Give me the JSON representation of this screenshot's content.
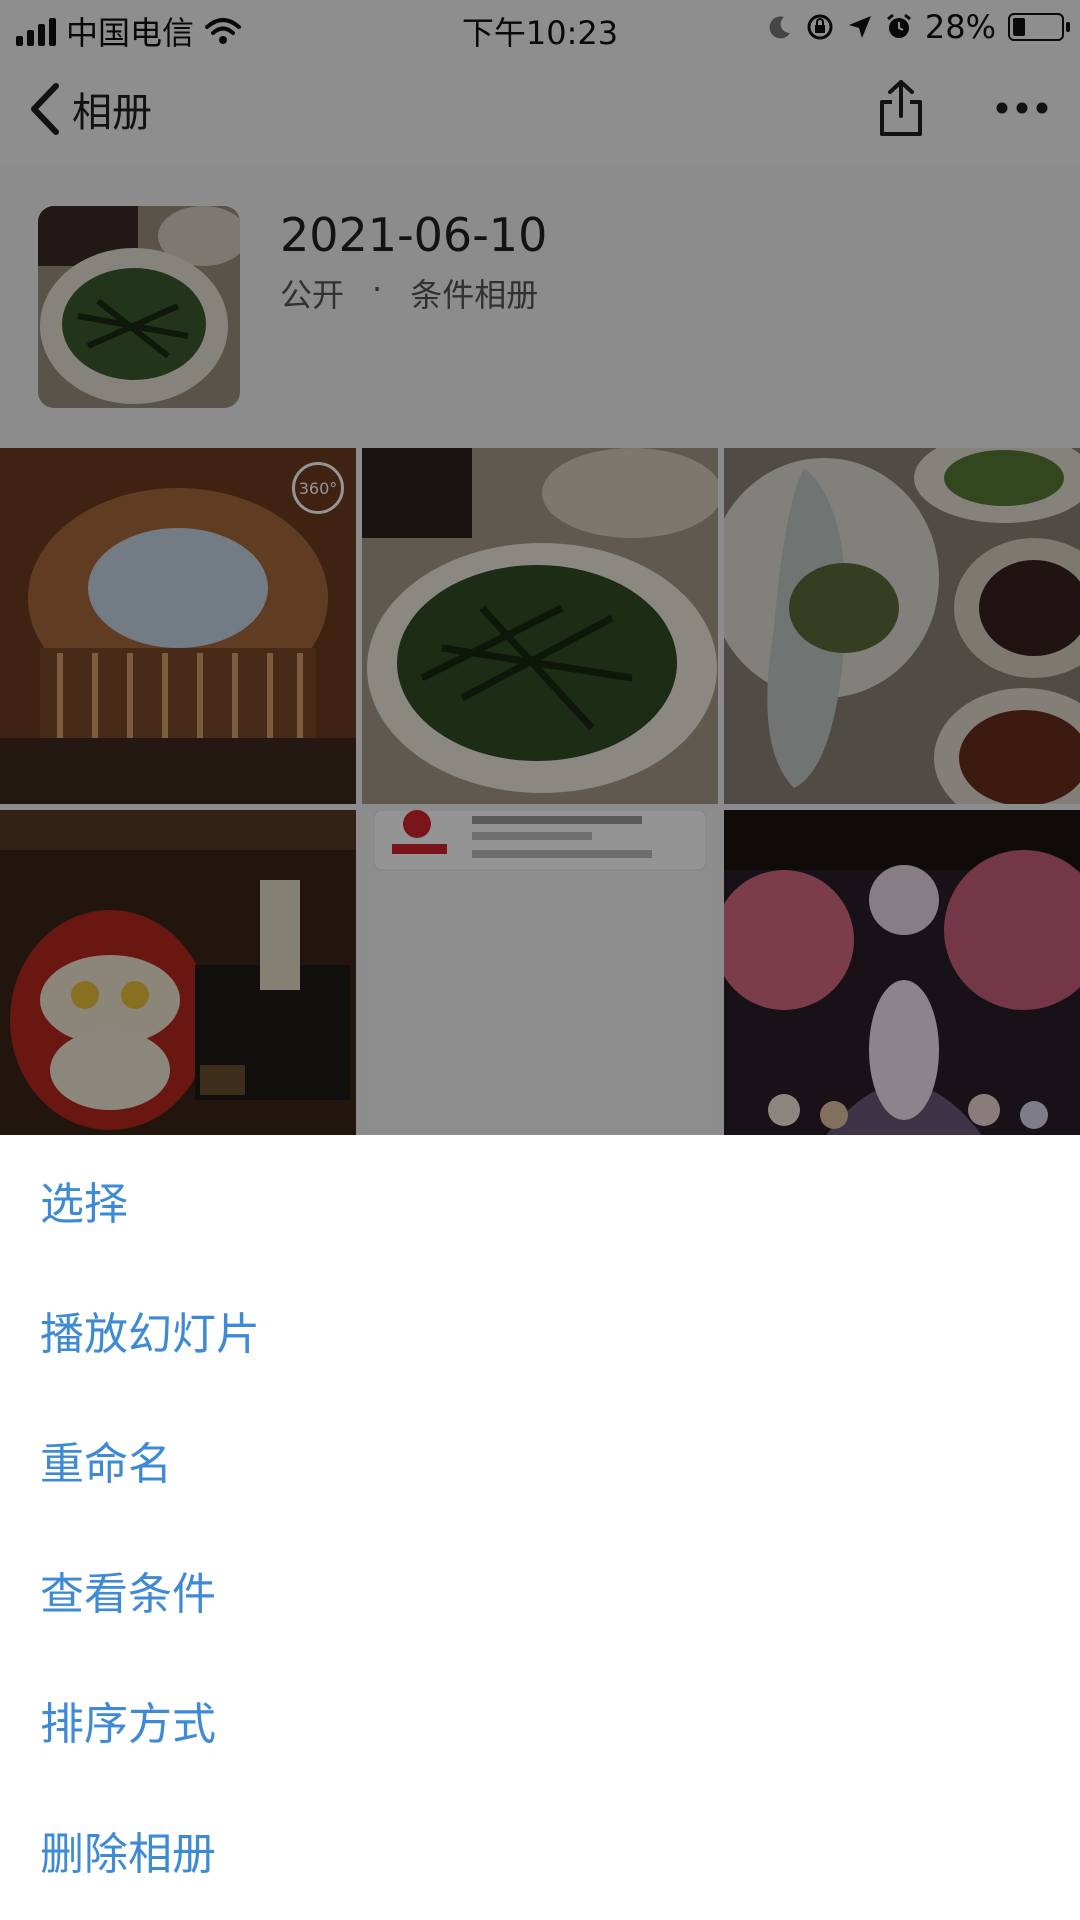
{
  "status_bar": {
    "carrier": "中国电信",
    "time": "下午10:23",
    "battery_text": "28%",
    "battery_level": 0.28
  },
  "nav": {
    "back_label": "相册",
    "icons": [
      "back-chevron-icon",
      "share-icon",
      "more-icon"
    ]
  },
  "album": {
    "date": "2021-06-10",
    "visibility": "公开",
    "separator": "·",
    "type": "条件相册"
  },
  "photos": [
    {
      "subject": "panorama-interior",
      "badge": "360°"
    },
    {
      "subject": "food-plate"
    },
    {
      "subject": "fish-dish"
    },
    {
      "subject": "game-screenshot-1"
    },
    {
      "subject": "coupon-screenshot"
    },
    {
      "subject": "game-screenshot-2"
    }
  ],
  "action_sheet": {
    "items": [
      "选择",
      "播放幻灯片",
      "重命名",
      "查看条件",
      "排序方式",
      "删除相册"
    ]
  },
  "colors": {
    "accent": "#3f8ad4",
    "overlay": "rgba(0,0,0,0.42)"
  }
}
